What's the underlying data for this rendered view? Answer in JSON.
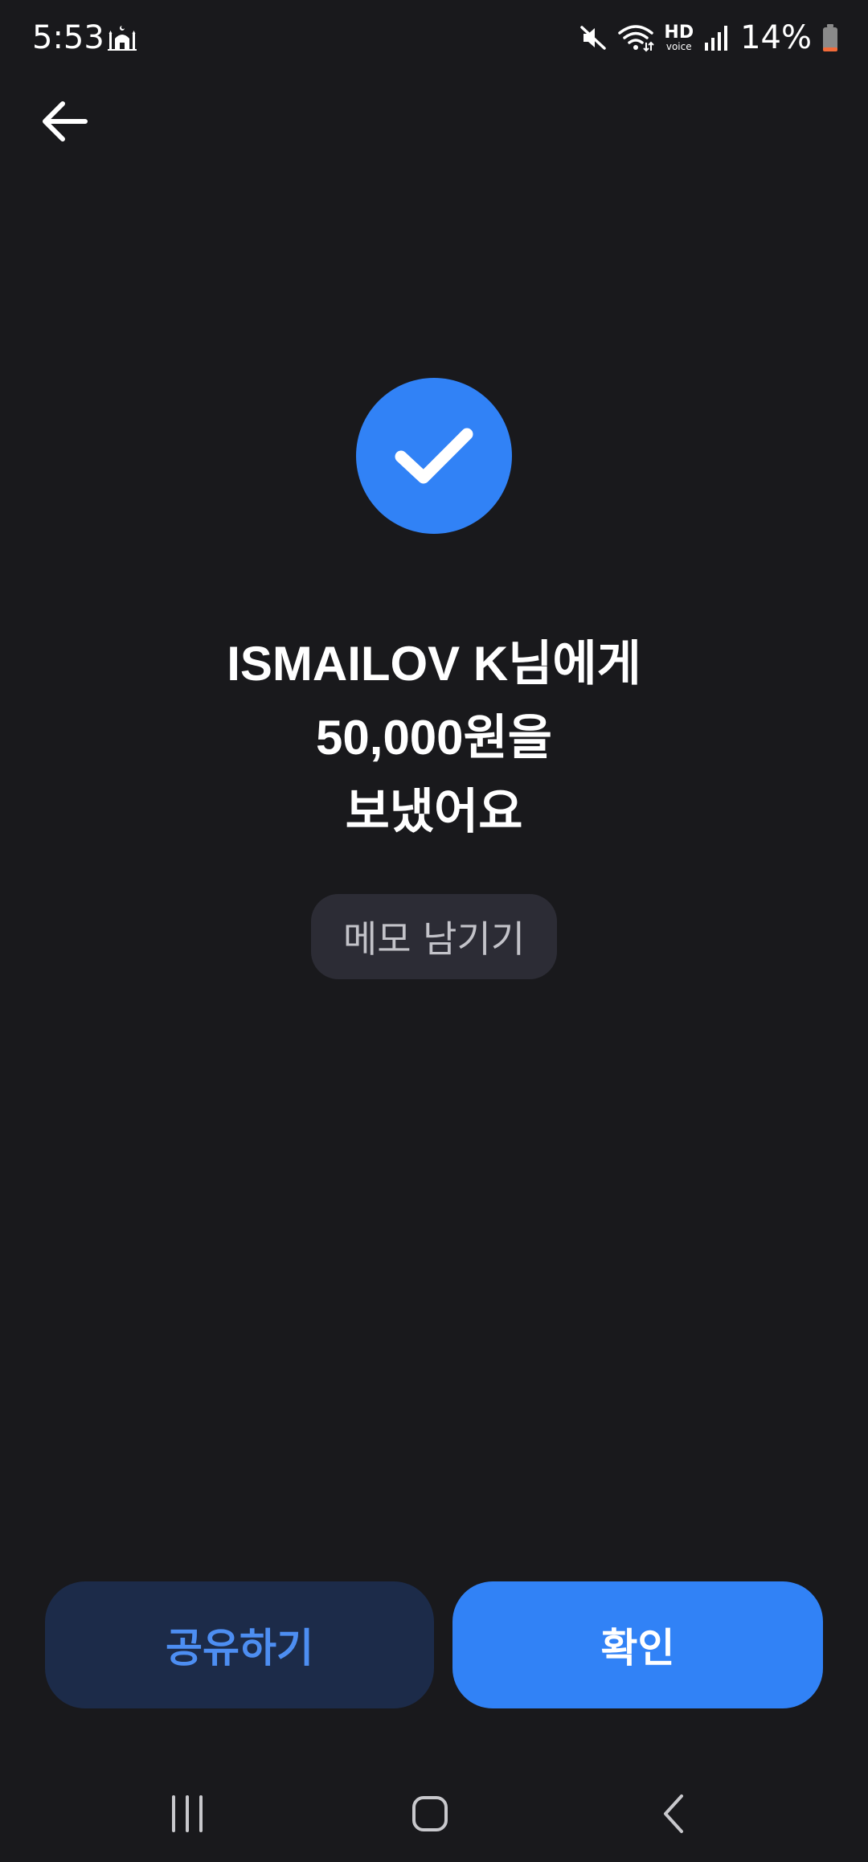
{
  "status_bar": {
    "time": "5:53",
    "battery_percent": "14%",
    "hd_label": "HD",
    "voice_label": "voice",
    "icons": [
      "mosque-icon",
      "mute-icon",
      "wifi-icon",
      "hd-voice-icon",
      "signal-icon",
      "battery-icon"
    ]
  },
  "header": {
    "back_icon": "back-arrow-icon"
  },
  "result": {
    "icon": "check-circle-icon",
    "line1": "ISMAILOV K님에게",
    "line2": "50,000원을",
    "line3": "보냈어요"
  },
  "memo": {
    "label": "메모 남기기"
  },
  "actions": {
    "share_label": "공유하기",
    "confirm_label": "확인"
  },
  "navigation": {
    "icons": [
      "recents-icon",
      "home-icon",
      "back-icon"
    ]
  },
  "colors": {
    "background": "#19191c",
    "accent": "#3182f6",
    "share_bg": "#1c2b49",
    "share_text": "#4d8ef2",
    "memo_bg": "#2c2c35"
  }
}
